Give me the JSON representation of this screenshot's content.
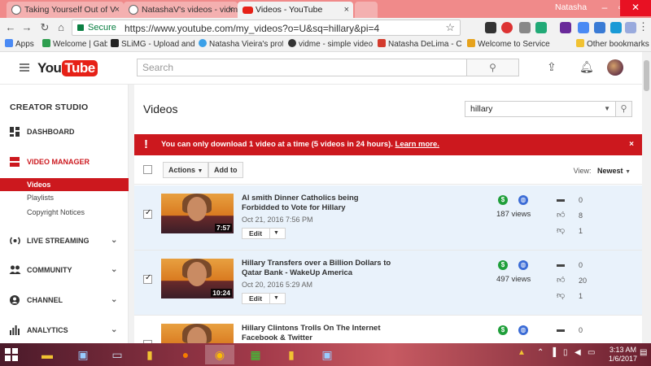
{
  "browser": {
    "tabs": [
      {
        "title": "Taking Yourself Out of V",
        "active": false
      },
      {
        "title": "NatashaV's videos - vidm",
        "active": false
      },
      {
        "title": "Videos - YouTube",
        "active": true
      }
    ],
    "user_name": "Natasha",
    "secure_label": "Secure",
    "url": "https://www.youtube.com/my_videos?o=U&sq=hillary&pi=4",
    "bookmarks": [
      {
        "label": "Apps",
        "color": "#4a8af4"
      },
      {
        "label": "Welcome | Gab",
        "color": "#2e9e4f"
      },
      {
        "label": "SLiMG - Upload and S",
        "color": "#222222"
      },
      {
        "label": "Natasha Vieira's profi",
        "color": "#3aa0e8"
      },
      {
        "label": "vidme - simple video",
        "color": "#333333"
      },
      {
        "label": "Natasha DeLima - Cha",
        "color": "#d33a2c"
      },
      {
        "label": "Welcome to Service C",
        "color": "#e6a21c"
      },
      {
        "label": "Other bookmarks",
        "color": "#f1c232"
      }
    ]
  },
  "youtube": {
    "logo_you": "You",
    "logo_tube": "Tube",
    "search_placeholder": "Search"
  },
  "sidebar": {
    "title": "CREATOR STUDIO",
    "items": [
      {
        "label": "DASHBOARD",
        "icon": "dashboard-icon",
        "active": false,
        "expandable": false
      },
      {
        "label": "VIDEO MANAGER",
        "icon": "video-manager-icon",
        "active": true,
        "expandable": false
      },
      {
        "label": "LIVE STREAMING",
        "icon": "live-streaming-icon",
        "active": false,
        "expandable": true
      },
      {
        "label": "COMMUNITY",
        "icon": "community-icon",
        "active": false,
        "expandable": true
      },
      {
        "label": "CHANNEL",
        "icon": "channel-icon",
        "active": false,
        "expandable": true
      },
      {
        "label": "ANALYTICS",
        "icon": "analytics-icon",
        "active": false,
        "expandable": true
      }
    ],
    "subitems": [
      {
        "label": "Videos",
        "active": true
      },
      {
        "label": "Playlists",
        "active": false
      },
      {
        "label": "Copyright Notices",
        "active": false
      }
    ]
  },
  "main": {
    "title": "Videos",
    "search_value": "hillary",
    "alert": {
      "message": "You can only download 1 video at a time (5 videos in 24 hours).",
      "link": "Learn more.",
      "close": "×"
    },
    "actions_label": "Actions",
    "add_to_label": "Add to",
    "view_label": "View:",
    "view_value": "Newest",
    "edit_label": "Edit",
    "videos": [
      {
        "title": "Al smith Dinner Catholics being Forbidded to Vote for Hillary",
        "date": "Oct 21, 2016 7:56 PM",
        "duration": "7:57",
        "views": "187 views",
        "comments": "0",
        "likes": "8",
        "dislikes": "1",
        "selected": true
      },
      {
        "title": "Hillary Transfers over a Billion Dollars to Qatar Bank - WakeUp America",
        "date": "Oct 20, 2016 5:29 AM",
        "duration": "10:24",
        "views": "497 views",
        "comments": "0",
        "likes": "20",
        "dislikes": "1",
        "selected": true
      },
      {
        "title": "Hillary Clintons Trolls On The Internet Facebook & Twitter",
        "date": "",
        "duration": "",
        "views": "",
        "comments": "0",
        "likes": "",
        "dislikes": "",
        "selected": false
      }
    ]
  },
  "taskbar": {
    "time": "3:13 AM",
    "date": "1/6/2017"
  },
  "colors": {
    "youtube_red": "#e62117",
    "studio_red": "#cc181e",
    "secure_green": "#0b8043"
  }
}
